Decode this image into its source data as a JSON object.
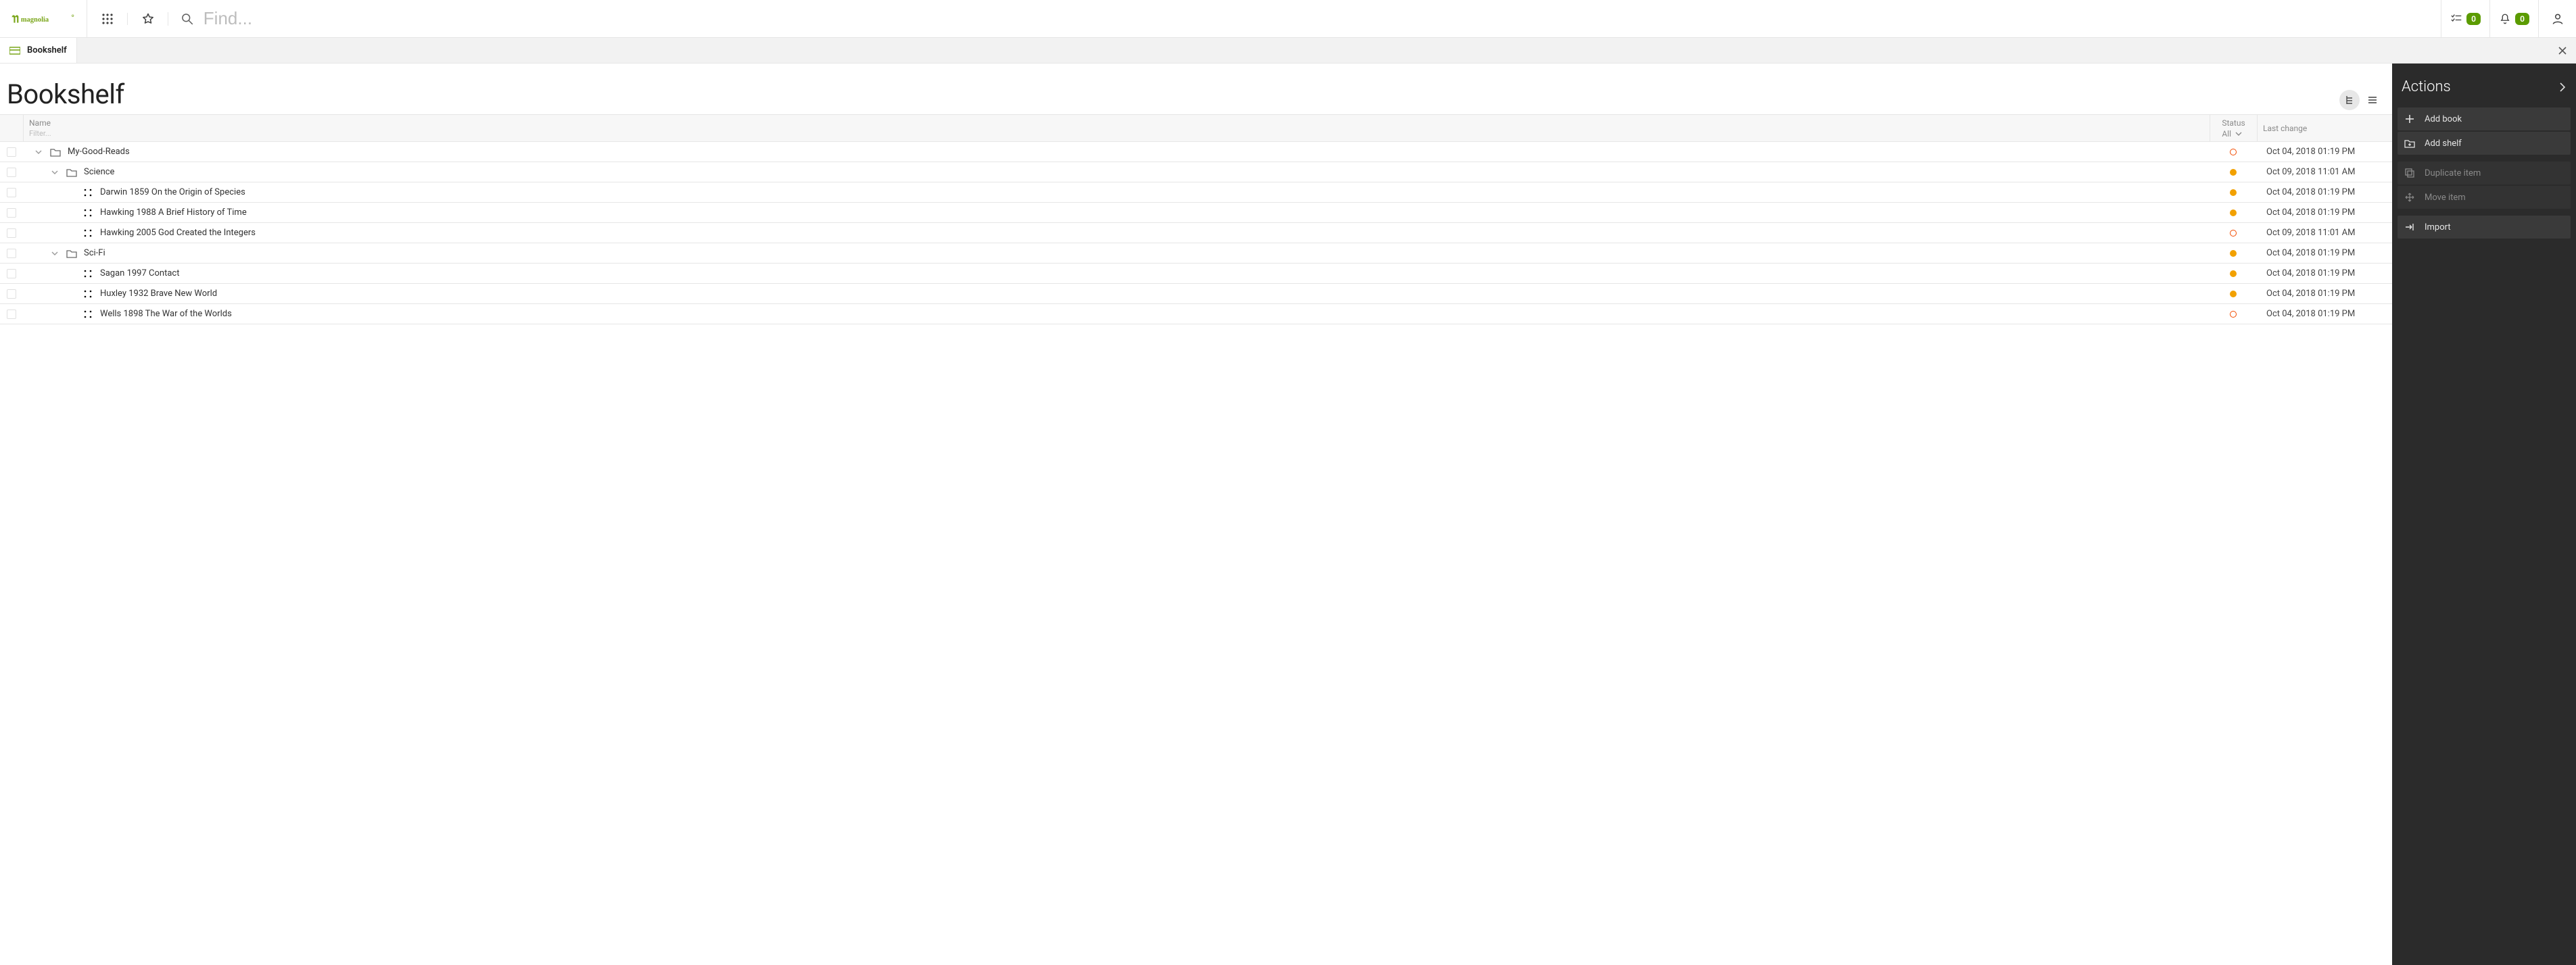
{
  "header": {
    "logo_text": "magnolia",
    "search_placeholder": "Find...",
    "tasks_count": "0",
    "notifications_count": "0"
  },
  "app_tab": {
    "label": "Bookshelf"
  },
  "page": {
    "title": "Bookshelf"
  },
  "columns": {
    "name": "Name",
    "name_filter_placeholder": "Filter...",
    "status": "Status",
    "status_filter": "All",
    "last_change": "Last change"
  },
  "rows": [
    {
      "indent": 0,
      "expander": "open",
      "type": "folder",
      "name": "My-Good-Reads",
      "status": {
        "color": "red",
        "filled": false
      },
      "last": "Oct 04, 2018 01:19 PM"
    },
    {
      "indent": 1,
      "expander": "open",
      "type": "folder",
      "name": "Science",
      "status": {
        "color": "orange",
        "filled": true
      },
      "last": "Oct 09, 2018 11:01 AM"
    },
    {
      "indent": 2,
      "expander": "none",
      "type": "item",
      "name": "Darwin 1859 On the Origin of Species",
      "status": {
        "color": "orange",
        "filled": true
      },
      "last": "Oct 04, 2018 01:19 PM"
    },
    {
      "indent": 2,
      "expander": "none",
      "type": "item",
      "name": "Hawking 1988 A Brief History of Time",
      "status": {
        "color": "orange",
        "filled": true
      },
      "last": "Oct 04, 2018 01:19 PM"
    },
    {
      "indent": 2,
      "expander": "none",
      "type": "item",
      "name": "Hawking 2005 God Created the Integers",
      "status": {
        "color": "red",
        "filled": false
      },
      "last": "Oct 09, 2018 11:01 AM"
    },
    {
      "indent": 1,
      "expander": "open",
      "type": "folder",
      "name": "Sci-Fi",
      "status": {
        "color": "orange",
        "filled": true
      },
      "last": "Oct 04, 2018 01:19 PM"
    },
    {
      "indent": 2,
      "expander": "none",
      "type": "item",
      "name": "Sagan 1997 Contact",
      "status": {
        "color": "orange",
        "filled": true
      },
      "last": "Oct 04, 2018 01:19 PM"
    },
    {
      "indent": 2,
      "expander": "none",
      "type": "item",
      "name": "Huxley 1932 Brave New World",
      "status": {
        "color": "orange",
        "filled": true
      },
      "last": "Oct 04, 2018 01:19 PM"
    },
    {
      "indent": 2,
      "expander": "none",
      "type": "item",
      "name": "Wells 1898 The War of the Worlds",
      "status": {
        "color": "red",
        "filled": false
      },
      "last": "Oct 04, 2018 01:19 PM"
    }
  ],
  "sidebar": {
    "title": "Actions",
    "groups": [
      [
        {
          "id": "add-book",
          "label": "Add book",
          "icon": "plus",
          "enabled": true
        },
        {
          "id": "add-shelf",
          "label": "Add shelf",
          "icon": "add-folder",
          "enabled": true
        }
      ],
      [
        {
          "id": "duplicate",
          "label": "Duplicate item",
          "icon": "duplicate",
          "enabled": false
        },
        {
          "id": "move",
          "label": "Move item",
          "icon": "move",
          "enabled": false
        }
      ],
      [
        {
          "id": "import",
          "label": "Import",
          "icon": "import",
          "enabled": true
        }
      ]
    ]
  }
}
